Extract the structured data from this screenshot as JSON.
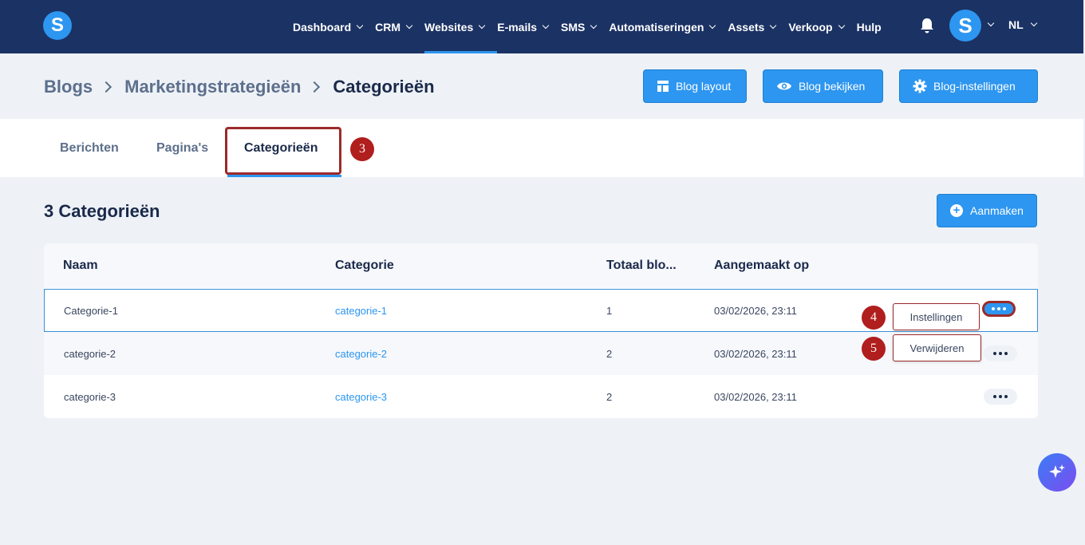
{
  "app": {
    "logo_letter": "S",
    "avatar_letter": "S",
    "language": "NL"
  },
  "nav": {
    "items": [
      {
        "label": "Dashboard",
        "dropdown": true
      },
      {
        "label": "CRM",
        "dropdown": true
      },
      {
        "label": "Websites",
        "dropdown": true,
        "active": true
      },
      {
        "label": "E-mails",
        "dropdown": true
      },
      {
        "label": "SMS",
        "dropdown": true
      },
      {
        "label": "Automatiseringen",
        "dropdown": true
      },
      {
        "label": "Assets",
        "dropdown": true
      },
      {
        "label": "Verkoop",
        "dropdown": true
      },
      {
        "label": "Hulp",
        "dropdown": false
      }
    ]
  },
  "breadcrumb": [
    "Blogs",
    "Marketingstrategieën",
    "Categorieën"
  ],
  "header_buttons": {
    "blog_layout": "Blog layout",
    "blog_view": "Blog bekijken",
    "blog_settings": "Blog-instellingen"
  },
  "tabs": [
    "Berichten",
    "Pagina's",
    "Categorieën"
  ],
  "markers": {
    "tab": "3",
    "settings": "4",
    "delete": "5"
  },
  "section": {
    "title": "3 Categorieën",
    "create_label": "Aanmaken"
  },
  "table": {
    "headers": [
      "Naam",
      "Categorie",
      "Totaal blo...",
      "Aangemaakt op"
    ],
    "rows": [
      {
        "name": "Categorie-1",
        "category": "categorie-1",
        "total": "1",
        "created": "03/02/2026, 23:11"
      },
      {
        "name": "categorie-2",
        "category": "categorie-2",
        "total": "2",
        "created": "03/02/2026, 23:11"
      },
      {
        "name": "categorie-3",
        "category": "categorie-3",
        "total": "2",
        "created": "03/02/2026, 23:11"
      }
    ]
  },
  "row_menu": {
    "settings": "Instellingen",
    "delete": "Verwijderen"
  },
  "colors": {
    "nav_bg": "#1b3264",
    "accent": "#2d96f0",
    "marker": "#b01e1e",
    "highlight_border": "#9c2a2a"
  }
}
